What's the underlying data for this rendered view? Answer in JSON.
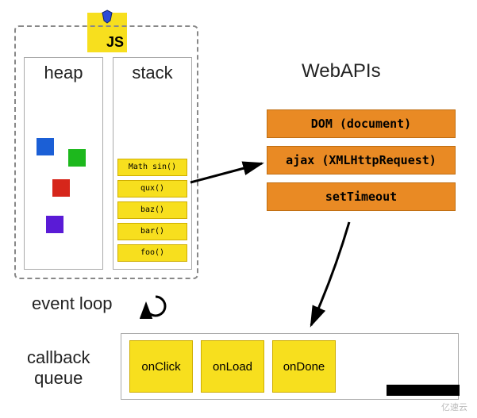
{
  "badge": {
    "label": "JS"
  },
  "engine": {
    "heap_title": "heap",
    "stack_title": "stack",
    "stack_items": [
      "Math sin()",
      "qux()",
      "baz()",
      "bar()",
      "foo()"
    ]
  },
  "webapis": {
    "title": "WebAPIs",
    "rows": [
      "DOM (document)",
      "ajax (XMLHttpRequest)",
      "setTimeout"
    ]
  },
  "eventloop": {
    "label": "event loop"
  },
  "callback": {
    "label_line1": "callback",
    "label_line2": "queue",
    "items": [
      "onClick",
      "onLoad",
      "onDone"
    ]
  },
  "watermark": "亿速云",
  "colors": {
    "js_yellow": "#f7df1e",
    "api_orange": "#e98a24",
    "blue": "#1b5fd6",
    "green": "#1db81d",
    "red": "#d6261b",
    "purple": "#5a1bd6"
  }
}
